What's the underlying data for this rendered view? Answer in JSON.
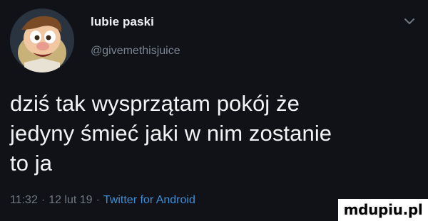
{
  "tweet": {
    "author_name": "lubie paski",
    "author_handle": "@givemethisjuice",
    "text_lines": [
      "dziś tak wysprzątam pokój że",
      "jedyny śmieć jaki w nim zostanie",
      "to ja"
    ],
    "time": "11:32",
    "date": "12 lut 19",
    "separator": "·",
    "source": "Twitter for Android",
    "avatar_icon": "cartoon-character-avatar",
    "menu_icon": "chevron-down-icon"
  },
  "watermark": {
    "text": "mdupiu.pl"
  },
  "colors": {
    "background": "#101217",
    "text": "#f2f3f5",
    "muted": "#7b8591",
    "link": "#3a8fd6"
  }
}
